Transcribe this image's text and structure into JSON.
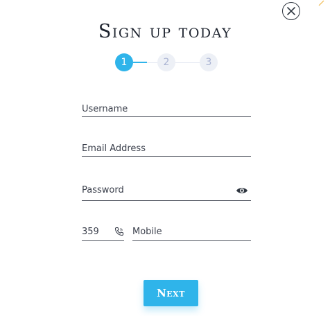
{
  "header": {
    "title": "Sign up today",
    "close_icon": "close-icon"
  },
  "stepper": {
    "steps": [
      "1",
      "2",
      "3"
    ],
    "current": 1
  },
  "form": {
    "username": {
      "label": "Username",
      "value": ""
    },
    "email": {
      "label": "Email Address",
      "value": ""
    },
    "password": {
      "label": "Password",
      "value": "",
      "toggle_icon": "eye-icon"
    },
    "phone": {
      "country_code": "359",
      "code_icon": "phone-icon",
      "mobile_label": "Mobile",
      "value": ""
    }
  },
  "actions": {
    "next_label": "Next"
  },
  "colors": {
    "accent": "#2fb4ea",
    "step_inactive_bg": "#edf0f6",
    "step_inactive_text": "#a9b3d2",
    "text": "#3a3f4b",
    "underline": "#4a4f5a"
  }
}
